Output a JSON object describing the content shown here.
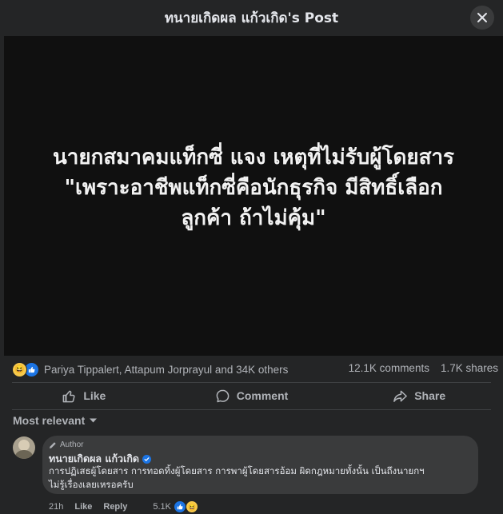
{
  "header": {
    "title": "ทนายเกิดผล แก้วเกิด's Post"
  },
  "post": {
    "image_text_lines": [
      "นายกสมาคมแท็กซี่ แจง เหตุที่ไม่รับผู้โดยสาร",
      "\"เพราะอาชีพแท็กซี่คือนักธุรกิจ มีสิทธิ์เลือก",
      "ลูกค้า ถ้าไม่คุ้ม\""
    ]
  },
  "stats": {
    "reactors": "Pariya Tippalert, Attapum Jorprayul and 34K others",
    "comments": "12.1K comments",
    "shares": "1.7K shares"
  },
  "actions": {
    "like": "Like",
    "comment": "Comment",
    "share": "Share"
  },
  "sort": {
    "label": "Most relevant"
  },
  "comment": {
    "badge": "Author",
    "name": "ทนายเกิดผล แก้วเกิด",
    "text_lines": [
      "การปฏิเสธผู้โดยสาร การทอดทิ้งผู้โดยสาร การพาผู้โดยสารอ้อม ผิดกฎหมายทั้งนั้น เป็นถึงนายกฯ",
      "ไม่รู้เรื่องเลยเหรอครับ"
    ],
    "time": "21h",
    "like": "Like",
    "reply": "Reply",
    "reaction_count": "5.1K"
  },
  "colors": {
    "accent": "#1b74e4",
    "haha": "#f7c94b",
    "background": "#242526",
    "bubble": "#3a3b3c"
  },
  "icons": [
    "close-icon",
    "like-icon",
    "comment-icon",
    "share-icon",
    "caret-down-icon",
    "pencil-icon",
    "verified-icon",
    "haha-reaction-icon",
    "like-reaction-icon"
  ]
}
